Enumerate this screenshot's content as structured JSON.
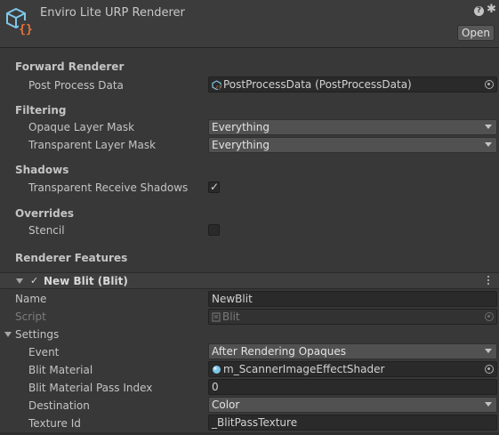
{
  "header": {
    "title": "Enviro Lite URP Renderer",
    "open_label": "Open",
    "help_icon": "help-icon",
    "settings_icon": "gear-icon"
  },
  "forward_renderer": {
    "title": "Forward Renderer",
    "post_process_label": "Post Process Data",
    "post_process_value": "PostProcessData (PostProcessData)"
  },
  "filtering": {
    "title": "Filtering",
    "opaque_label": "Opaque Layer Mask",
    "opaque_value": "Everything",
    "transparent_label": "Transparent Layer Mask",
    "transparent_value": "Everything"
  },
  "shadows": {
    "title": "Shadows",
    "receive_label": "Transparent Receive Shadows",
    "receive_checked": true
  },
  "overrides": {
    "title": "Overrides",
    "stencil_label": "Stencil",
    "stencil_checked": false
  },
  "renderer_features": {
    "title": "Renderer Features",
    "feature_name": "New Blit (Blit)",
    "feature_enabled": true,
    "name_label": "Name",
    "name_value": "NewBlit",
    "script_label": "Script",
    "script_value": "Blit",
    "settings_label": "Settings",
    "event_label": "Event",
    "event_value": "After Rendering Opaques",
    "material_label": "Blit Material",
    "material_value": "m_ScannerImageEffectShader",
    "pass_index_label": "Blit Material Pass Index",
    "pass_index_value": "0",
    "destination_label": "Destination",
    "destination_value": "Color",
    "texture_id_label": "Texture Id",
    "texture_id_value": "_BlitPassTexture"
  },
  "colors": {
    "background": "#383838",
    "field": "#2a2a2a",
    "dropdown": "#515151",
    "text": "#c4c4c4",
    "icon_blue": "#7fc7e8",
    "icon_orange": "#e8743b"
  }
}
